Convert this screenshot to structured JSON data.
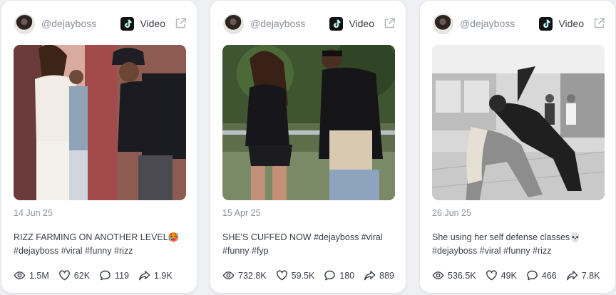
{
  "posts": [
    {
      "handle": "@dejayboss",
      "type_label": "Video",
      "date": "14 Jun 25",
      "caption": "RIZZ FARMING ON ANOTHER LEVEL🥵 #dejayboss #viral #funny #rizz",
      "views": "1.5M",
      "likes": "62K",
      "comments": "119",
      "shares": "1.9K",
      "thumbnail_alt": "couple-at-mall-pink"
    },
    {
      "handle": "@dejayboss",
      "type_label": "Video",
      "date": "15 Apr 25",
      "caption": "SHE'S CUFFED NOW #dejayboss #viral #funny #fyp",
      "views": "732.8K",
      "likes": "59.5K",
      "comments": "180",
      "shares": "889",
      "thumbnail_alt": "couple-outdoor-handcuff"
    },
    {
      "handle": "@dejayboss",
      "type_label": "Video",
      "date": "26 Jun 25",
      "caption": "She using her self defense classes💀 #dejayboss #viral #funny #rizz",
      "views": "536.5K",
      "likes": "49K",
      "comments": "466",
      "shares": "7.8K",
      "thumbnail_alt": "mall-self-defense-grayscale"
    }
  ],
  "colors": {
    "card_bg": "#ffffff",
    "page_bg": "#eef0f4",
    "muted_text": "#8a8f99",
    "body_text": "#3a3e49"
  },
  "icons": {
    "platform": "tiktok-icon",
    "external": "external-link-icon",
    "views": "eye-icon",
    "likes": "heart-icon",
    "comments": "comment-icon",
    "shares": "share-icon"
  }
}
